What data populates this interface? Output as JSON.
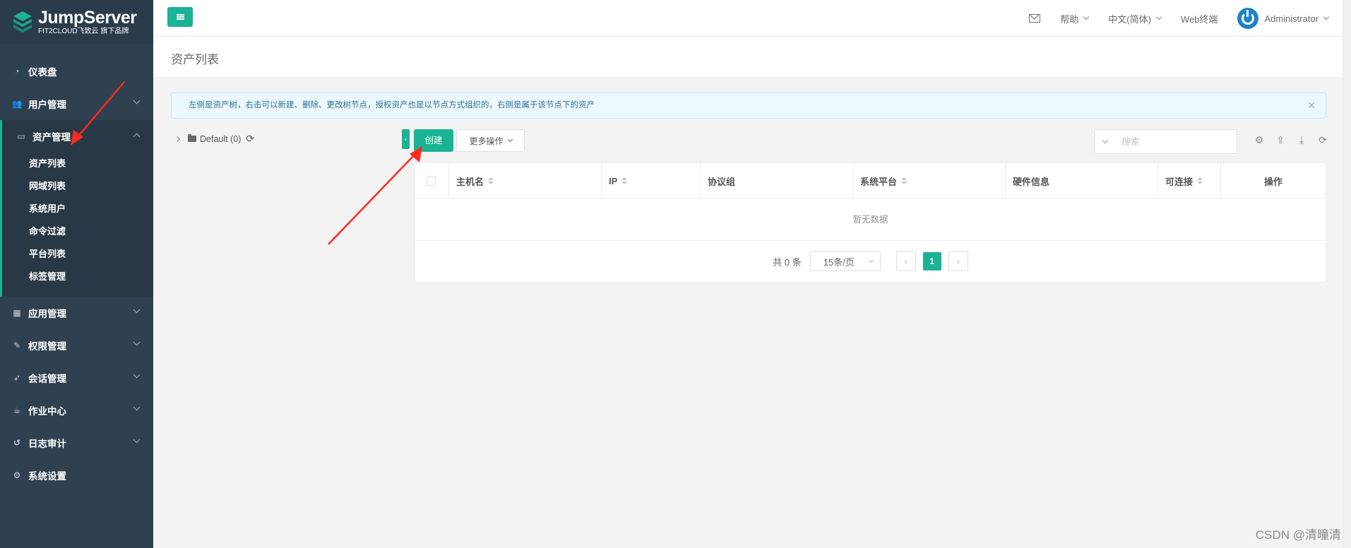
{
  "brand": {
    "title": "JumpServer",
    "subtitle": "FIT2CLOUD飞致云 旗下品牌"
  },
  "sidebar": {
    "items": [
      {
        "label": "仪表盘",
        "icon": "dashboard-icon"
      },
      {
        "label": "用户管理",
        "icon": "users-icon"
      },
      {
        "label": "资产管理",
        "icon": "inbox-icon"
      },
      {
        "label": "应用管理",
        "icon": "apps-grid-icon"
      },
      {
        "label": "权限管理",
        "icon": "edit-icon"
      },
      {
        "label": "会话管理",
        "icon": "rocket-icon"
      },
      {
        "label": "作业中心",
        "icon": "coffee-icon"
      },
      {
        "label": "日志审计",
        "icon": "history-icon"
      },
      {
        "label": "系统设置",
        "icon": "gears-icon"
      }
    ],
    "asset_submenu": [
      "资产列表",
      "网域列表",
      "系统用户",
      "命令过滤",
      "平台列表",
      "标签管理"
    ]
  },
  "topbar": {
    "help": "帮助",
    "language": "中文(简体)",
    "web_terminal": "Web终端",
    "user": "Administrator"
  },
  "page": {
    "title": "资产列表",
    "alert": "左侧是资产树，右击可以新建、删除、更改树节点，授权资产也是以节点方式组织的，右侧是属于该节点下的资产"
  },
  "tree": {
    "root": "Default (0)"
  },
  "toolbar": {
    "create": "创建",
    "more": "更多操作",
    "search_placeholder": "搜索"
  },
  "table": {
    "columns": [
      "主机名",
      "IP",
      "协议组",
      "系统平台",
      "硬件信息",
      "可连接",
      "操作"
    ],
    "empty_text": "暂无数据"
  },
  "pagination": {
    "total": "共 0 条",
    "page_size": "15条/页",
    "current_page": "1"
  },
  "watermark": "CSDN @清曈清",
  "colors": {
    "accent": "#1ab394",
    "sidebar": "#2f4050",
    "annotation": "#ff2a1e"
  }
}
